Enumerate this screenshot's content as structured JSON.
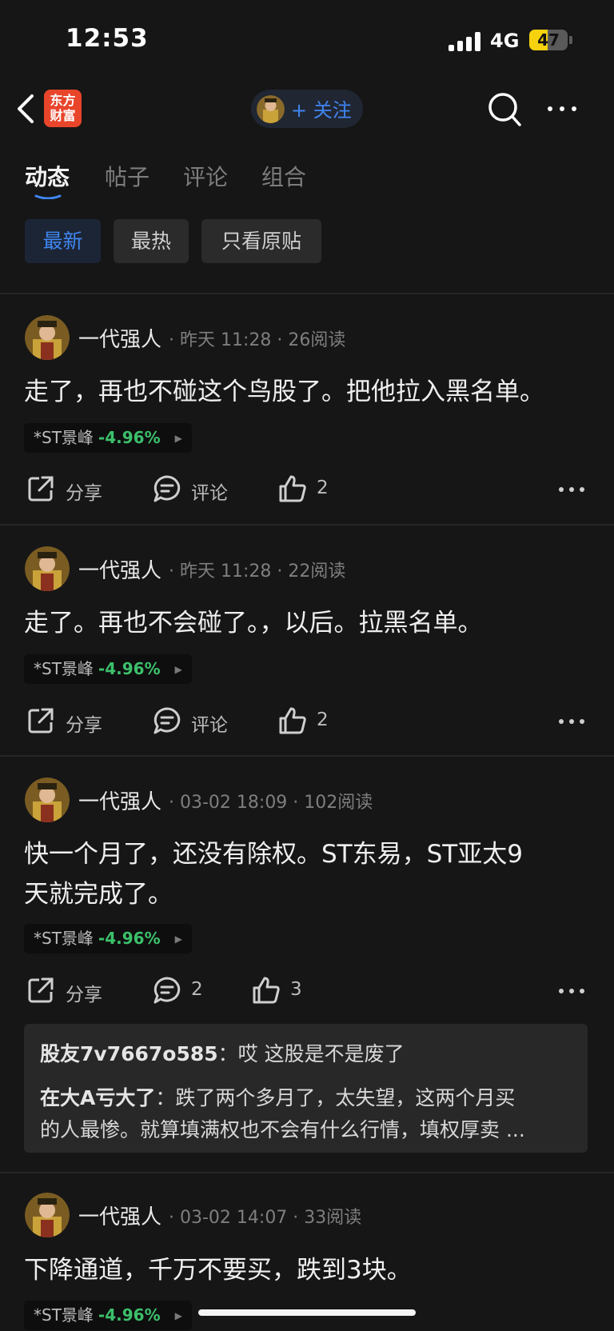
{
  "status_bar": {
    "time": "12:53",
    "network": "4G",
    "battery": "47"
  },
  "nav": {
    "logo_line1": "东方",
    "logo_line2": "财富",
    "follow_label": "+ 关注"
  },
  "tabs": [
    "动态",
    "帖子",
    "评论",
    "组合"
  ],
  "filters": [
    "最新",
    "最热",
    "只看原贴"
  ],
  "posts": [
    {
      "author": "一代强人",
      "meta": "· 昨天 11:28 · 26阅读",
      "content": "走了，再也不碰这个鸟股了。把他拉入黑名单。",
      "stock": "*ST景峰",
      "change": "-4.96%",
      "share_label": "分享",
      "comment_label": "评论",
      "likes": "2"
    },
    {
      "author": "一代强人",
      "meta": "· 昨天 11:28 · 22阅读",
      "content": "走了。再也不会碰了。，以后。拉黑名单。",
      "stock": "*ST景峰",
      "change": "-4.96%",
      "share_label": "分享",
      "comment_label": "评论",
      "likes": "2"
    },
    {
      "author": "一代强人",
      "meta": "· 03-02 18:09 · 102阅读",
      "content_line1": "快一个月了，还没有除权。ST东易，ST亚太9",
      "content_line2": "天就完成了。",
      "stock": "*ST景峰",
      "change": "-4.96%",
      "share_label": "分享",
      "comment_label": "2",
      "likes": "3",
      "replies": [
        {
          "user": "股友7v7667o585",
          "text": "：哎 这股是不是废了"
        },
        {
          "user": "在大A亏大了",
          "text": "：跌了两个多月了，太失望，这两个月买"
        },
        {
          "user": "",
          "text": "的人最惨。就算填满权也不会有什么行情，填权厚卖 ..."
        }
      ]
    },
    {
      "author": "一代强人",
      "meta": "· 03-02 14:07 · 33阅读",
      "content": "下降通道，千万不要买，跌到3块。",
      "stock": "*ST景峰",
      "change": "-4.96%"
    }
  ],
  "colors": {
    "accent": "#3f86f2",
    "positive_green": "#3cc06b",
    "brand_red": "#e8452b"
  }
}
